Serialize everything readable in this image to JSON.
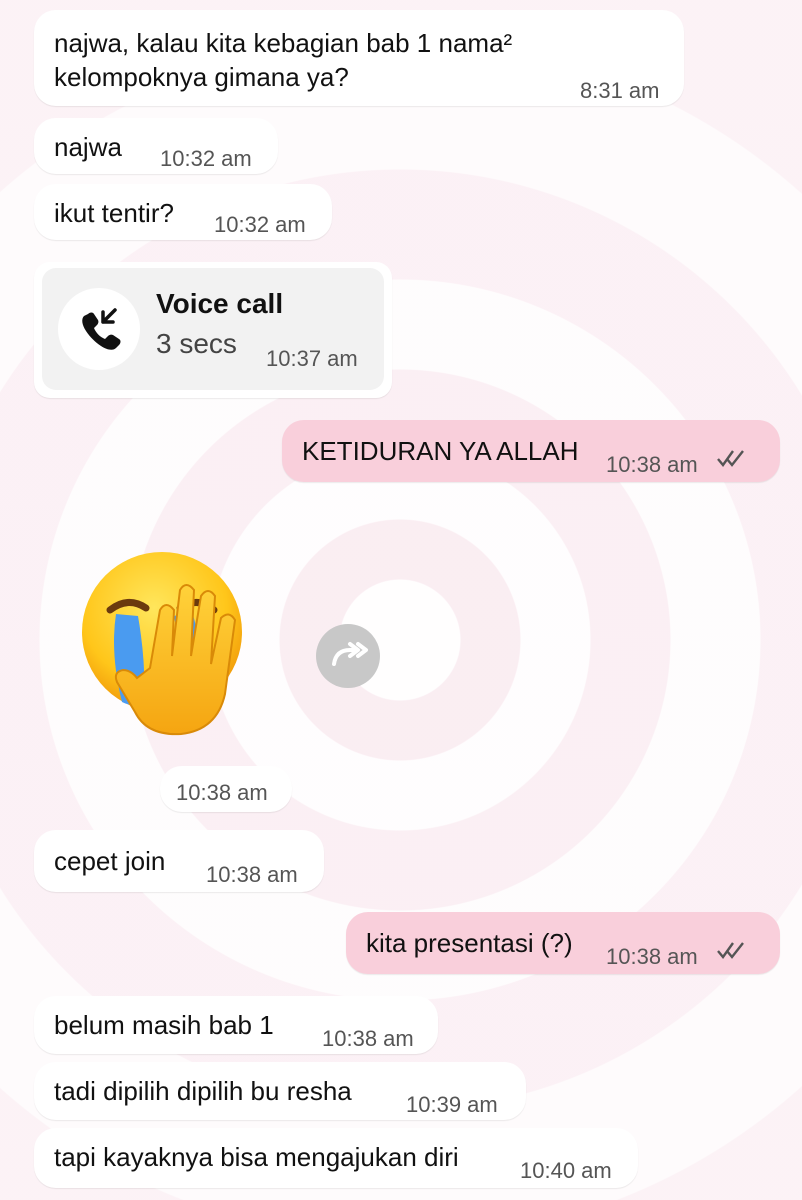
{
  "messages": [
    {
      "text": "najwa, kalau kita kebagian bab 1 nama² kelompoknya gimana ya?",
      "time": "8:31 am"
    },
    {
      "text": "najwa",
      "time": "10:32 am"
    },
    {
      "text": "ikut tentir?",
      "time": "10:32 am"
    },
    {
      "text": "KETIDURAN YA ALLAH",
      "time": "10:38 am"
    },
    {
      "text": "cepet join",
      "time": "10:38 am"
    },
    {
      "text": "kita presentasi (?)",
      "time": "10:38 am"
    },
    {
      "text": "belum masih bab 1",
      "time": "10:38 am"
    },
    {
      "text": "tadi dipilih dipilih bu resha",
      "time": "10:39 am"
    },
    {
      "text": "tapi kayaknya bisa mengajukan diri",
      "time": "10:40 am"
    }
  ],
  "voice_call": {
    "title": "Voice call",
    "duration": "3 secs",
    "time": "10:37 am",
    "icon": "incoming-call-icon"
  },
  "sticker": {
    "icon": "crying-face-covering-emoji",
    "time": "10:38 am",
    "forward_icon": "forward-icon"
  },
  "colors": {
    "incoming_bubble": "#ffffff",
    "outgoing_bubble": "#f9cfdb",
    "call_card": "#f2f2f2"
  }
}
